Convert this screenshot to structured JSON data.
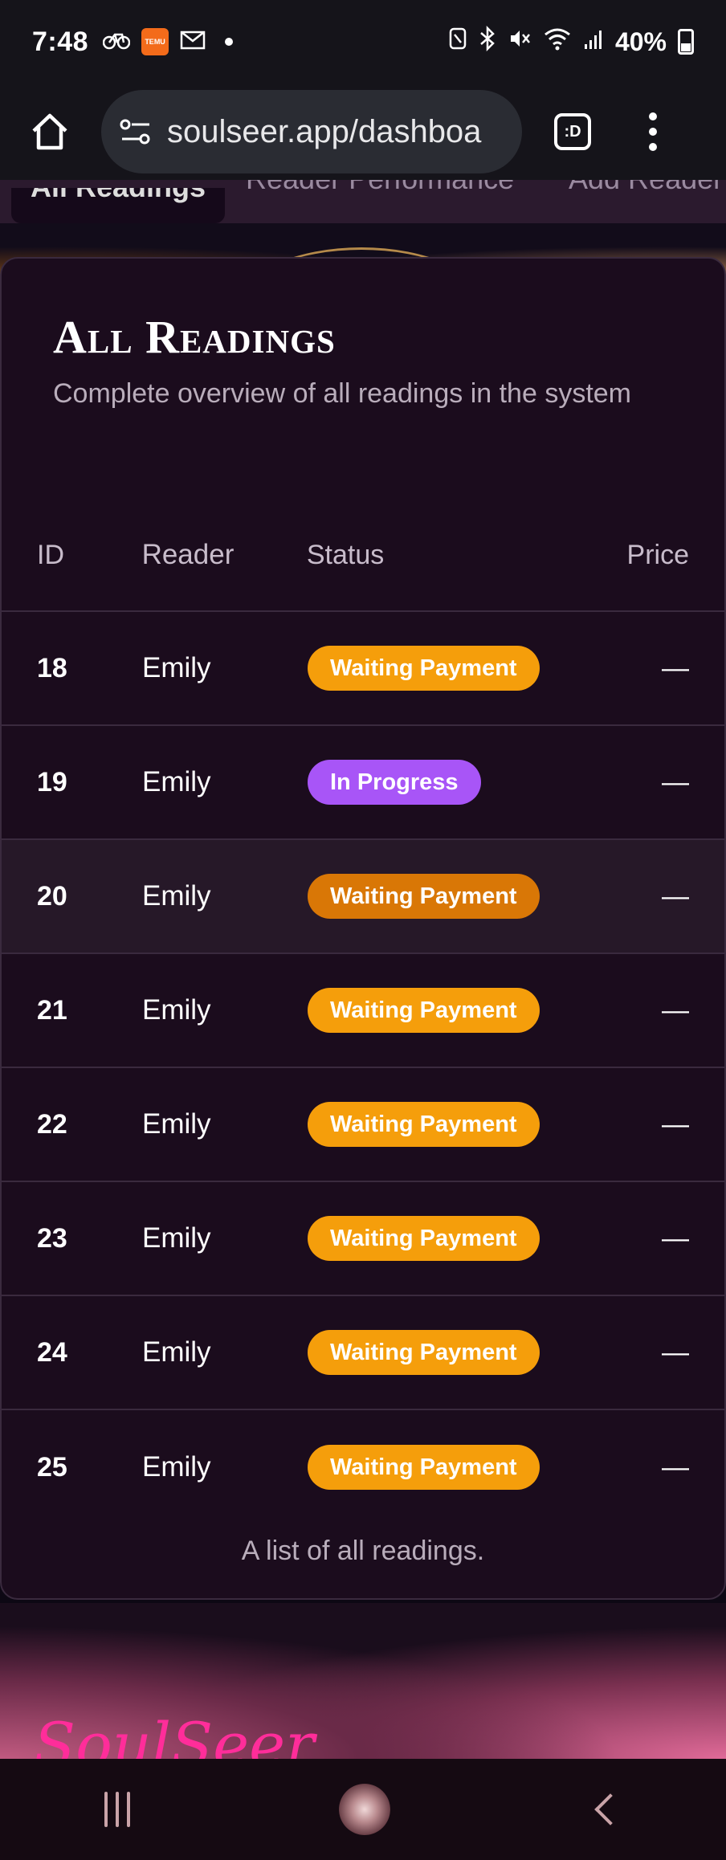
{
  "statusbar": {
    "time": "7:48",
    "temu_label": "TEMU",
    "battery": "40%",
    "icons": [
      "bike-icon",
      "temu-app-icon",
      "mail-icon",
      "dot-icon",
      "nfc-icon",
      "bluetooth-icon",
      "mute-icon",
      "wifi-icon",
      "signal-icon",
      "battery-icon"
    ]
  },
  "browser": {
    "url": "soulseer.app/dashboa",
    "tab_switcher_label": ":D"
  },
  "tabs": {
    "active": "All Readings",
    "items": [
      "All Readings",
      "Reader Performance",
      "Add Reader"
    ]
  },
  "card": {
    "title": "All Readings",
    "subtitle": "Complete overview of all readings in the system",
    "columns": [
      "ID",
      "Reader",
      "Status",
      "Price"
    ],
    "rows": [
      {
        "id": "18",
        "reader": "Emily",
        "status": "Waiting Payment",
        "price": "—"
      },
      {
        "id": "19",
        "reader": "Emily",
        "status": "In Progress",
        "price": "—"
      },
      {
        "id": "20",
        "reader": "Emily",
        "status": "Waiting Payment",
        "price": "—"
      },
      {
        "id": "21",
        "reader": "Emily",
        "status": "Waiting Payment",
        "price": "—"
      },
      {
        "id": "22",
        "reader": "Emily",
        "status": "Waiting Payment",
        "price": "—"
      },
      {
        "id": "23",
        "reader": "Emily",
        "status": "Waiting Payment",
        "price": "—"
      },
      {
        "id": "24",
        "reader": "Emily",
        "status": "Waiting Payment",
        "price": "—"
      },
      {
        "id": "25",
        "reader": "Emily",
        "status": "Waiting Payment",
        "price": "—"
      }
    ],
    "caption": "A list of all readings."
  },
  "footer": {
    "brand": "SoulSeer"
  },
  "colors": {
    "waiting": "#f59e0b",
    "in_progress": "#a855f7",
    "card_bg": "#1b0c1d",
    "brand_pink": "#ff2d9a"
  }
}
